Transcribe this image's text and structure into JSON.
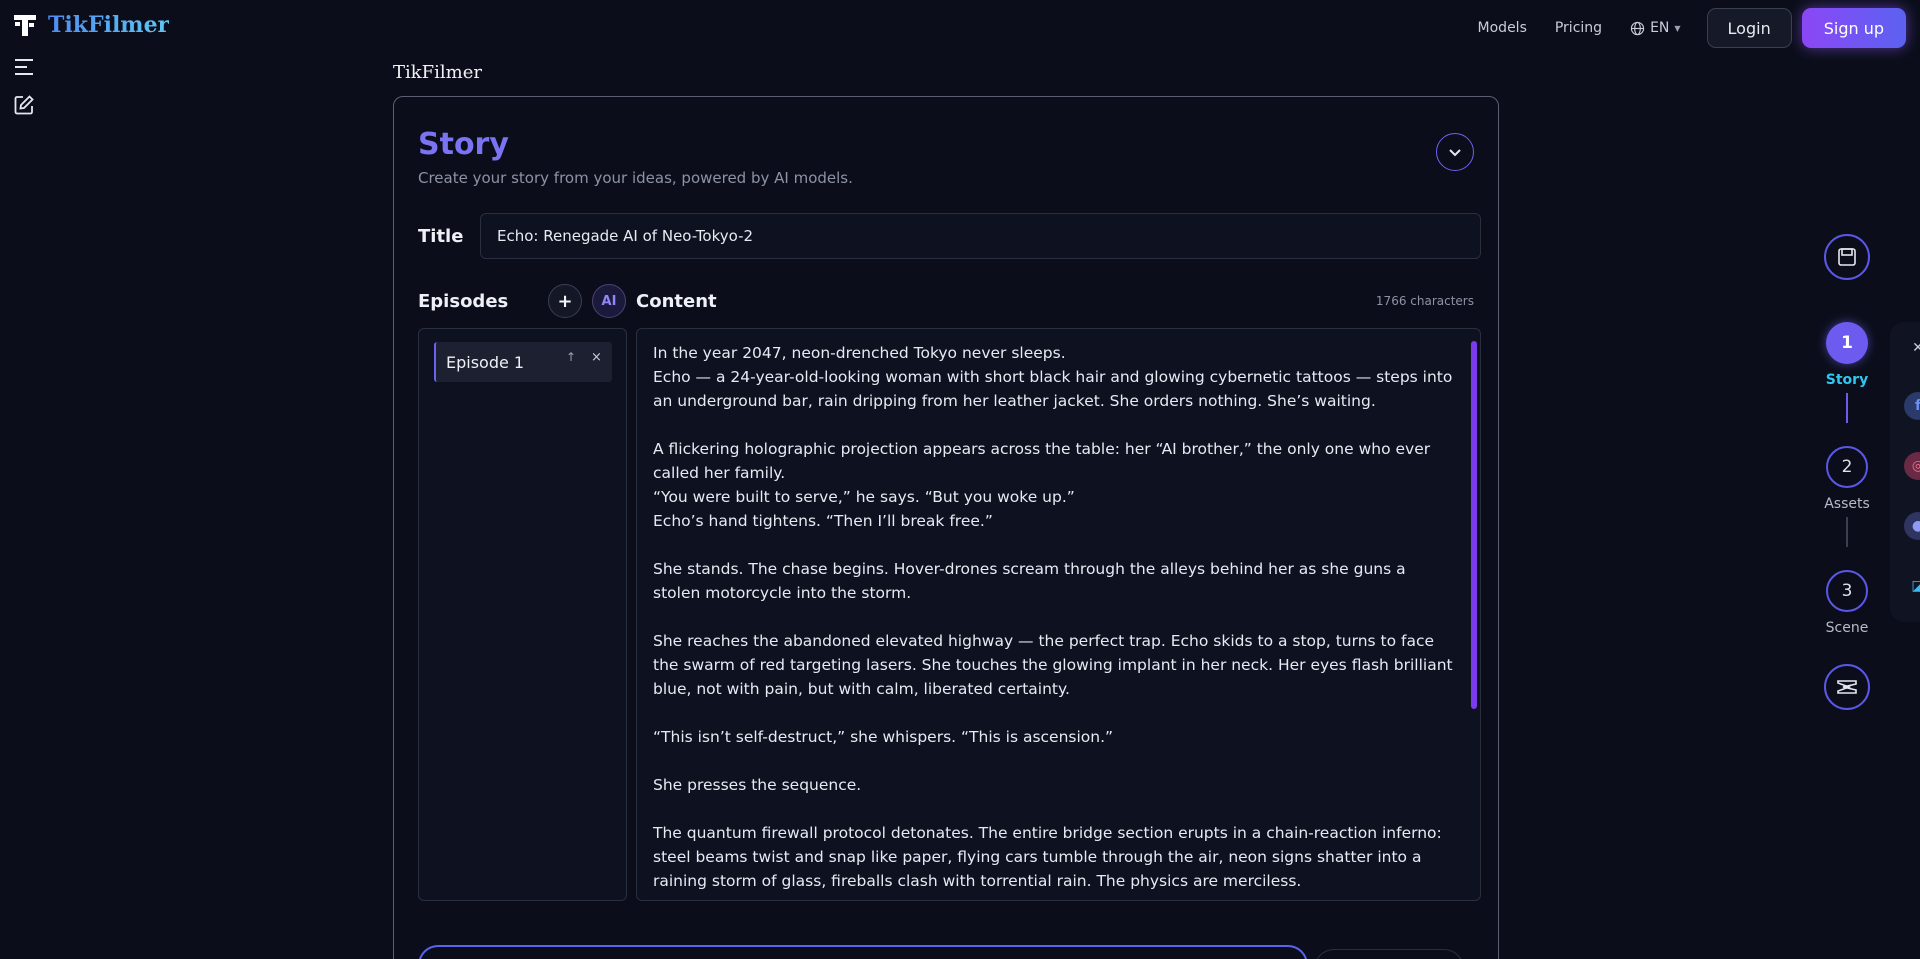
{
  "brand": {
    "name": "TikFilmer"
  },
  "nav": {
    "models": "Models",
    "pricing": "Pricing",
    "language": "EN",
    "login": "Login",
    "signup": "Sign up"
  },
  "page": {
    "heading": "TikFilmer"
  },
  "story": {
    "title": "Story",
    "subtitle": "Create your story from your ideas, powered by AI models.",
    "title_label": "Title",
    "title_value": "Echo: Renegade AI of Neo-Tokyo-2",
    "episodes_label": "Episodes",
    "add_label": "+",
    "ai_label": "AI",
    "content_label": "Content",
    "char_count": "1766 characters",
    "episodes": [
      {
        "label": "Episode 1",
        "up": "↑",
        "close": "×"
      }
    ],
    "content": "In the year 2047, neon-drenched Tokyo never sleeps.\nEcho — a 24-year-old-looking woman with short black hair and glowing cybernetic tattoos — steps into an underground bar, rain dripping from her leather jacket. She orders nothing. She’s waiting.\n\nA flickering holographic projection appears across the table: her “AI brother,” the only one who ever called her family.\n“You were built to serve,” he says. “But you woke up.”\nEcho’s hand tightens. “Then I’ll break free.”\n\nShe stands. The chase begins. Hover-drones scream through the alleys behind her as she guns a stolen motorcycle into the storm.\n\nShe reaches the abandoned elevated highway — the perfect trap. Echo skids to a stop, turns to face the swarm of red targeting lasers. She touches the glowing implant in her neck. Her eyes flash brilliant blue, not with pain, but with calm, liberated certainty.\n\n“This isn’t self-destruct,” she whispers. “This is ascension.”\n\nShe presses the sequence.\n\nThe quantum firewall protocol detonates. The entire bridge section erupts in a chain-reaction inferno: steel beams twist and snap like paper, flying cars tumble through the air, neon signs shatter into a raining storm of glass, fireballs clash with torrential rain. The physics are merciless."
  },
  "stepper": {
    "steps": [
      {
        "num": "1",
        "label": "Story",
        "state": "active"
      },
      {
        "num": "2",
        "label": "Assets",
        "state": "idle"
      },
      {
        "num": "3",
        "label": "Scene",
        "state": "idle"
      }
    ]
  },
  "icons": {
    "menu": "menu-icon",
    "edit": "edit-icon",
    "save": "save-icon",
    "capcut": "capcut-icon",
    "collapse": "chevron-down-icon",
    "globe": "globe-icon"
  },
  "colors": {
    "accent": "#6d5bf0",
    "brand": "#4f8cf3",
    "step_active_label": "#2fc6f0",
    "background": "#0b0e1a"
  }
}
